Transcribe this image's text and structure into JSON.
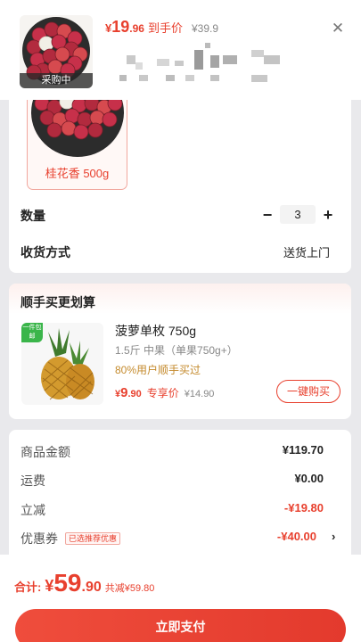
{
  "header": {
    "thumb_badge": "采购中",
    "price_currency": "¥",
    "price_int": "19",
    "price_dec": ".96",
    "price_tag": "到手价",
    "price_original": "¥39.9",
    "close_icon": "close-icon"
  },
  "product": {
    "spec_label": "桂花香 500g",
    "quantity_label": "数量",
    "quantity_minus": "−",
    "quantity_value": "3",
    "quantity_plus": "+",
    "delivery_label": "收货方式",
    "delivery_value": "送货上门"
  },
  "addon": {
    "section_title": "顺手买更划算",
    "tag": "一件包邮",
    "name": "菠萝单枚 750g",
    "sub": "1.5斤 中果（单果750g+）",
    "note": "80%用户顺手买过",
    "price_currency": "¥",
    "price_int": "9",
    "price_dec": ".90",
    "price_tag": "专享价",
    "price_original": "¥14.90",
    "buy_button": "一键购买"
  },
  "summary": {
    "rows": [
      {
        "label": "商品金额",
        "value": "¥119.70",
        "style": "normal"
      },
      {
        "label": "运费",
        "value": "¥0.00",
        "style": "normal"
      },
      {
        "label": "立减",
        "value": "-¥19.80",
        "style": "red"
      },
      {
        "label": "优惠券",
        "value": "-¥40.00",
        "style": "red",
        "badge": "已选推荐优惠"
      }
    ],
    "chevron": "›"
  },
  "footer": {
    "total_label": "合计:",
    "total_currency": "¥",
    "total_int": "59",
    "total_dec": ".90",
    "total_saved": "共减¥59.80",
    "pay_button": "立即支付"
  },
  "colors": {
    "accent": "#e8402e",
    "page_bg": "#e9e9ec",
    "note_gold": "#c48a2c"
  }
}
